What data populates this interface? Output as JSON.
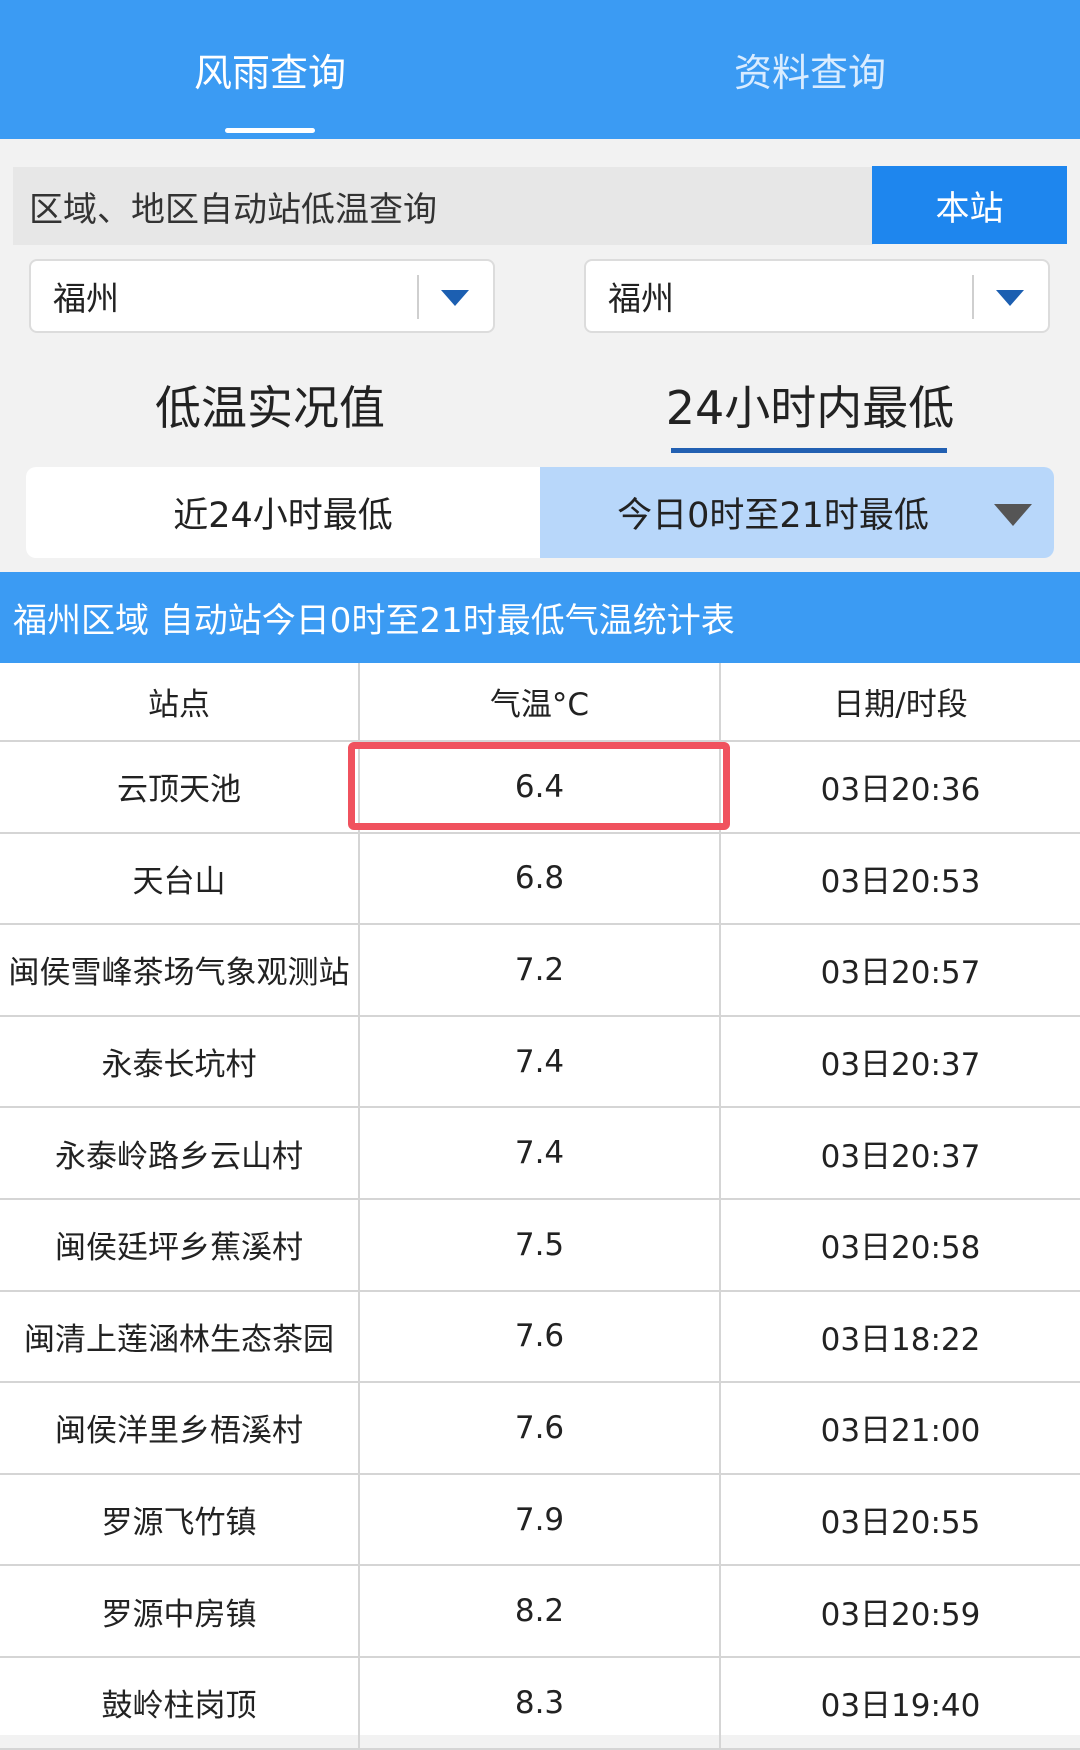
{
  "top_tabs": [
    {
      "label": "风雨查询",
      "active": true
    },
    {
      "label": "资料查询",
      "active": false
    }
  ],
  "query": {
    "label": "区域、地区自动站低温查询",
    "station_button": "本站"
  },
  "selects": {
    "left_value": "福州",
    "right_value": "福州"
  },
  "big_tabs": [
    {
      "label": "低温实况值",
      "active": false
    },
    {
      "label": "24小时内最低",
      "active": true
    }
  ],
  "sub_options": {
    "left": "近24小时最低",
    "right": "今日0时至21时最低"
  },
  "table": {
    "title": "福州区域 自动站今日0时至21时最低气温统计表",
    "headers": [
      "站点",
      "气温°C",
      "日期/时段"
    ],
    "rows": [
      [
        "云顶天池",
        "6.4",
        "03日20:36"
      ],
      [
        "天台山",
        "6.8",
        "03日20:53"
      ],
      [
        "闽侯雪峰茶场气象观测站",
        "7.2",
        "03日20:57"
      ],
      [
        "永泰长坑村",
        "7.4",
        "03日20:37"
      ],
      [
        "永泰岭路乡云山村",
        "7.4",
        "03日20:37"
      ],
      [
        "闽侯廷坪乡蕉溪村",
        "7.5",
        "03日20:58"
      ],
      [
        "闽清上莲涵林生态茶园",
        "7.6",
        "03日18:22"
      ],
      [
        "闽侯洋里乡梧溪村",
        "7.6",
        "03日21:00"
      ],
      [
        "罗源飞竹镇",
        "7.9",
        "03日20:55"
      ],
      [
        "罗源中房镇",
        "8.2",
        "03日20:59"
      ],
      [
        "鼓岭柱岗顶",
        "8.3",
        "03日19:40"
      ]
    ]
  },
  "colors": {
    "header_blue": "#3b9bf3",
    "button_blue": "#1e86ee",
    "selected_option": "#b8d7fa",
    "highlight_red": "#f0525e"
  }
}
